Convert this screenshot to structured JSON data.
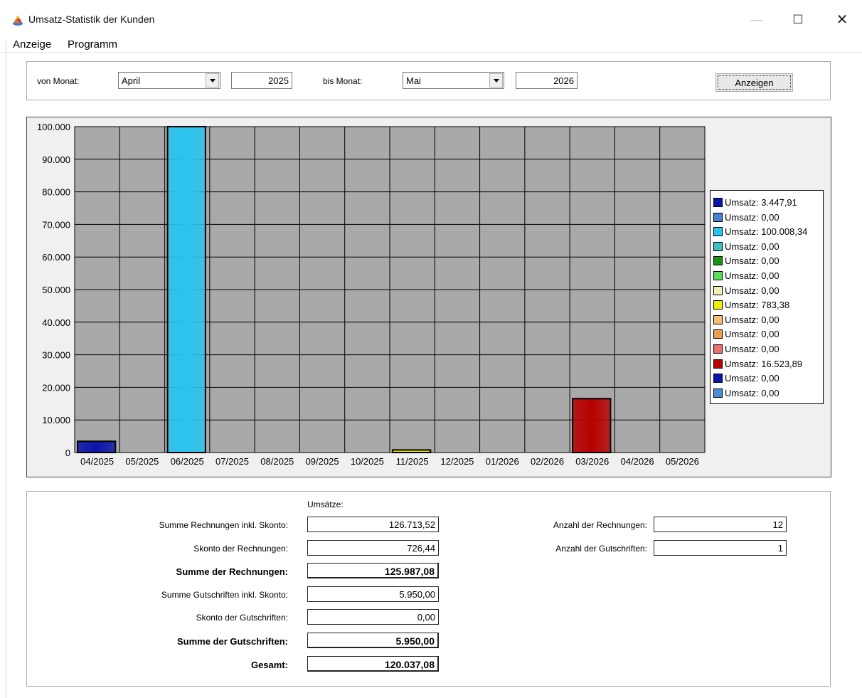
{
  "window": {
    "title": "Umsatz-Statistik der Kunden",
    "minimize_glyph": "—",
    "maximize_glyph": "☐",
    "close_glyph": "✕",
    "icon": "app-icon"
  },
  "menu": [
    "Anzeige",
    "Programm"
  ],
  "filter": {
    "from_label": "von Monat:",
    "from_month": "April",
    "from_year": "2025",
    "to_label": "bis Monat:",
    "to_month": "Mai",
    "to_year": "2026",
    "show_button": "Anzeigen"
  },
  "chart_data": {
    "type": "bar",
    "categories": [
      "04/2025",
      "05/2025",
      "06/2025",
      "07/2025",
      "08/2025",
      "09/2025",
      "10/2025",
      "11/2025",
      "12/2025",
      "01/2026",
      "02/2026",
      "03/2026",
      "04/2026",
      "05/2026"
    ],
    "values": [
      3447.91,
      0,
      100008.34,
      0,
      0,
      0,
      0,
      783.38,
      0,
      0,
      0,
      16523.89,
      0,
      0
    ],
    "colors": [
      "#0a14a8",
      "#4a7fcf",
      "#28c4f0",
      "#3cc0c0",
      "#149614",
      "#5ade5a",
      "#f4f0b4",
      "#f0f000",
      "#f4c070",
      "#e8a050",
      "#ec7070",
      "#b80000",
      "#0a14a8",
      "#4a8cdc"
    ],
    "yticks": [
      "100.000",
      "90.000",
      "80.000",
      "70.000",
      "60.000",
      "50.000",
      "40.000",
      "30.000",
      "20.000",
      "10.000",
      "0"
    ],
    "ylim": [
      0,
      100000
    ],
    "grid": true,
    "legend_position": "right",
    "legend": [
      "Umsatz: 3.447,91",
      "Umsatz: 0,00",
      "Umsatz: 100.008,34",
      "Umsatz: 0,00",
      "Umsatz: 0,00",
      "Umsatz: 0,00",
      "Umsatz: 0,00",
      "Umsatz: 783,38",
      "Umsatz: 0,00",
      "Umsatz: 0,00",
      "Umsatz: 0,00",
      "Umsatz: 16.523,89",
      "Umsatz: 0,00",
      "Umsatz: 0,00"
    ]
  },
  "summary": {
    "header": "Umsätze:",
    "rows": [
      {
        "label": "Summe  Rechnungen inkl. Skonto:",
        "value": "126.713,52"
      },
      {
        "label": "Skonto der Rechnungen:",
        "value": "726,44"
      },
      {
        "label": "Summe der Rechnungen:",
        "value": "125.987,08"
      },
      {
        "label": "Summe Gutschriften inkl. Skonto:",
        "value": "5.950,00"
      },
      {
        "label": "Skonto der Gutschriften:",
        "value": "0,00"
      },
      {
        "label": "Summe der Gutschriften:",
        "value": "5.950,00"
      },
      {
        "label": "Gesamt:",
        "value": "120.037,08"
      }
    ],
    "count_invoices_label": "Anzahl der Rechnungen:",
    "count_invoices": "12",
    "count_credits_label": "Anzahl der Gutschriften:",
    "count_credits": "1"
  }
}
